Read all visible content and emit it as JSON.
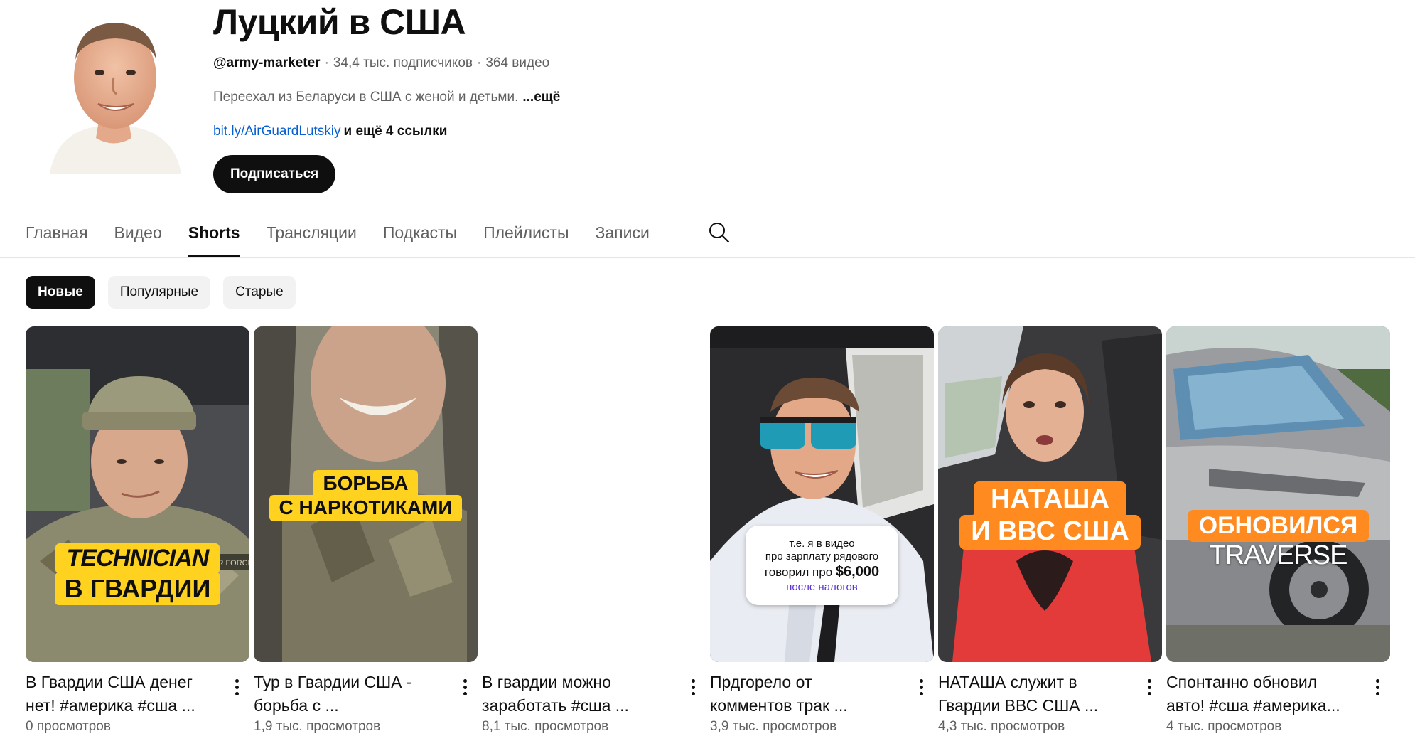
{
  "channel": {
    "title": "Луцкий в США",
    "handle": "@army-marketer",
    "subscribers": "34,4 тыс. подписчиков",
    "video_count": "364 видео",
    "separator": "·",
    "description": "Переехал из Беларуси в США с женой и детьми.",
    "description_more": "...ещё",
    "link": "bit.ly/AirGuardLutskiy",
    "link_more": "и ещё 4 ссылки",
    "subscribe_label": "Подписаться"
  },
  "tabs": [
    {
      "label": "Главная"
    },
    {
      "label": "Видео"
    },
    {
      "label": "Shorts"
    },
    {
      "label": "Трансляции"
    },
    {
      "label": "Подкасты"
    },
    {
      "label": "Плейлисты"
    },
    {
      "label": "Записи"
    }
  ],
  "active_tab": "Shorts",
  "chips": [
    {
      "label": "Новые"
    },
    {
      "label": "Популярные"
    },
    {
      "label": "Старые"
    }
  ],
  "active_chip": "Новые",
  "shorts": [
    {
      "title_line1": "В Гвардии США денег",
      "title_line2": "нет! #америка #сша ...",
      "views": "0 просмотров",
      "overlay_line1": "TECHNICIAN",
      "overlay_line2": "В ГВАРДИИ",
      "patch_text": "AIR FORCE"
    },
    {
      "title_line1": "Тур в Гвардии США -",
      "title_line2": "борьба с ...",
      "views": "1,9 тыс. просмотров",
      "overlay_line1": "БОРЬБА",
      "overlay_line2": "С НАРКОТИКАМИ"
    },
    {
      "title_line1": "В гвардии можно",
      "title_line2": "заработать #сша ...",
      "views": "8,1 тыс. просмотров"
    },
    {
      "title_line1": "Прдгорело от",
      "title_line2": "комментов трак ...",
      "views": "3,9 тыс. просмотров",
      "bubble_line1": "т.е. я в видео",
      "bubble_line2": "про зарплату рядового",
      "bubble_line3": "говорил про",
      "bubble_amount": "$6,000",
      "bubble_line4": "после налогов"
    },
    {
      "title_line1": "НАТАША служит в",
      "title_line2": "Гвардии ВВС США ...",
      "views": "4,3 тыс. просмотров",
      "overlay_line1": "НАТАША",
      "overlay_line2": "И ВВС США"
    },
    {
      "title_line1": "Спонтанно обновил",
      "title_line2": "авто! #сша #америка...",
      "views": "4 тыс. просмотров",
      "overlay_line1": "ОБНОВИЛСЯ",
      "overlay_line2": "TRAVERSE"
    }
  ],
  "colors": {
    "text_primary": "#0f0f0f",
    "text_secondary": "#606060",
    "link": "#065fd4",
    "chip_bg": "#f2f2f2",
    "caption_yellow": "#ffd21f",
    "caption_orange": "#ff8a1f"
  },
  "icons": [
    "search-icon",
    "more-vert-icon"
  ]
}
